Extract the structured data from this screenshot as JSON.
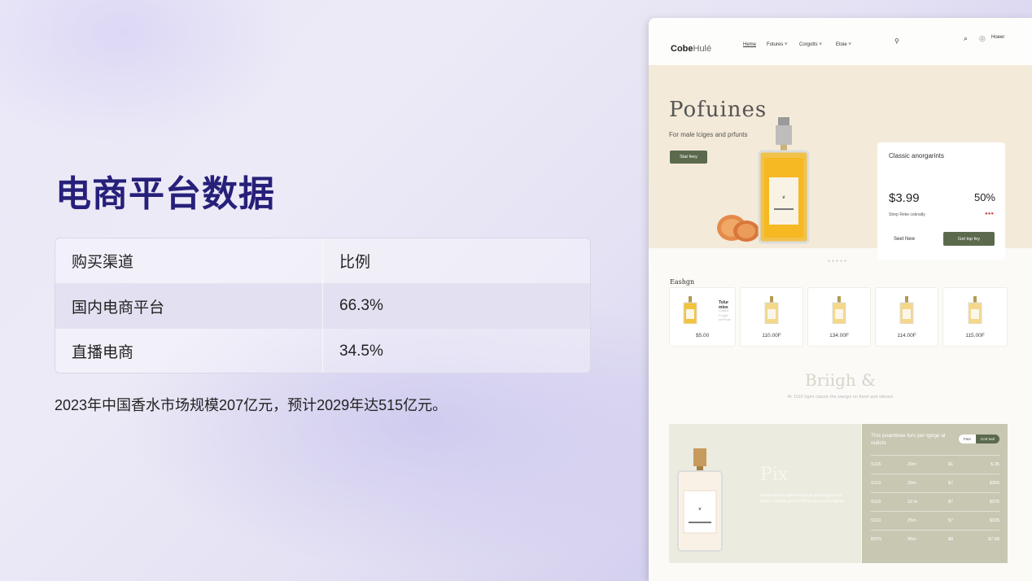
{
  "slide": {
    "title": "电商平台数据",
    "caption": "2023年中国香水市场规模207亿元，预计2029年达515亿元。"
  },
  "table": {
    "headers": [
      "购买渠道",
      "比例"
    ],
    "rows": [
      [
        "国内电商平台",
        "66.3%"
      ],
      [
        "直播电商",
        "34.5%"
      ]
    ]
  },
  "mockup": {
    "logo_bold": "Cobe",
    "logo_rest": "Hulé",
    "nav": [
      "Heme",
      "Fotures ˅",
      "Corgotts ˅",
      "Etoie ˅"
    ],
    "hover_label": "Hoeer",
    "hero_title": "Pofuines",
    "hero_subtitle": "For male lciges and prfunts",
    "hero_button": "Stat feey",
    "card_title": "Classic anorgarints",
    "card_price": "$3.99",
    "card_percent": "50%",
    "card_note": "Stnrp Reke coknalty",
    "card_link": "Seet New",
    "card_button": "Get top fey",
    "section_title": "Eashgn",
    "first_product_name": "Tolur mlox",
    "first_product_desc": "Lusted Fonge sn/Prost",
    "products": [
      "$5.00",
      "110.00F",
      "134.00F",
      "114.00F",
      "115.00F"
    ],
    "brand_title": "Briigh &",
    "brand_sub": "Ar 1016 lrgint classic the siangis on theet and wiloure",
    "feature_title": "Pix",
    "feature_text": "Pefitie tnetest mainved tipin pe pouaihg) kos ell aufors. Corkole gennal thnrig)tiyn seved inrignett.",
    "pricing_title": "This poantinee fors per tgrige al outicts",
    "pricing_tabs": [
      "Pate",
      "Cort tool"
    ],
    "pricing_rows": [
      [
        "S115",
        "20m",
        "$1",
        "$.35"
      ],
      [
        "S110",
        "20m",
        "$7",
        "$350"
      ],
      [
        "S115",
        "10 m",
        "$7",
        "$375"
      ],
      [
        "S110",
        "25m",
        "$7",
        "$335"
      ],
      [
        "B/PG",
        "95m",
        "$8",
        "$7.68"
      ]
    ],
    "colors": {
      "accent": "#5b6a4d",
      "hero_bg": "#f4ead9",
      "title": "#27207a"
    }
  }
}
